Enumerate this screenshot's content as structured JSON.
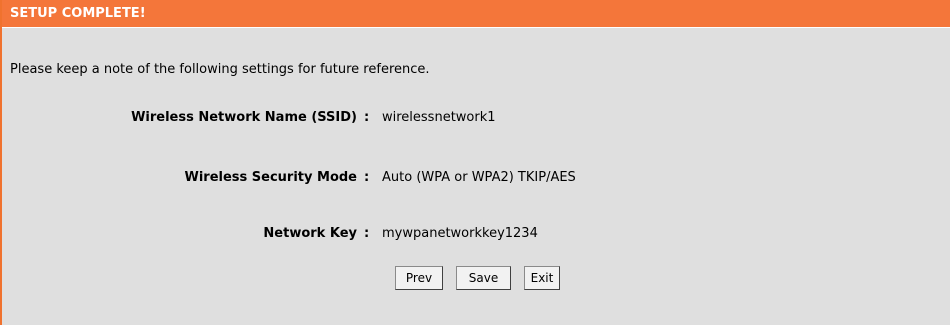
{
  "header": {
    "title": "SETUP COMPLETE!"
  },
  "intro": "Please keep a note of the following settings for future reference.",
  "settings": [
    {
      "label": "Wireless Network Name (SSID)",
      "separator": ":",
      "value": "wirelessnetwork1"
    },
    {
      "label": "Wireless Security Mode",
      "separator": ":",
      "value": "Auto (WPA or WPA2) TKIP/AES"
    },
    {
      "label": "Network Key",
      "separator": ":",
      "value": "mywpanetworkkey1234"
    }
  ],
  "buttons": {
    "prev": "Prev",
    "save": "Save",
    "exit": "Exit"
  },
  "colors": {
    "header_bg": "#f4763a",
    "panel_bg": "#dfdfdf"
  }
}
